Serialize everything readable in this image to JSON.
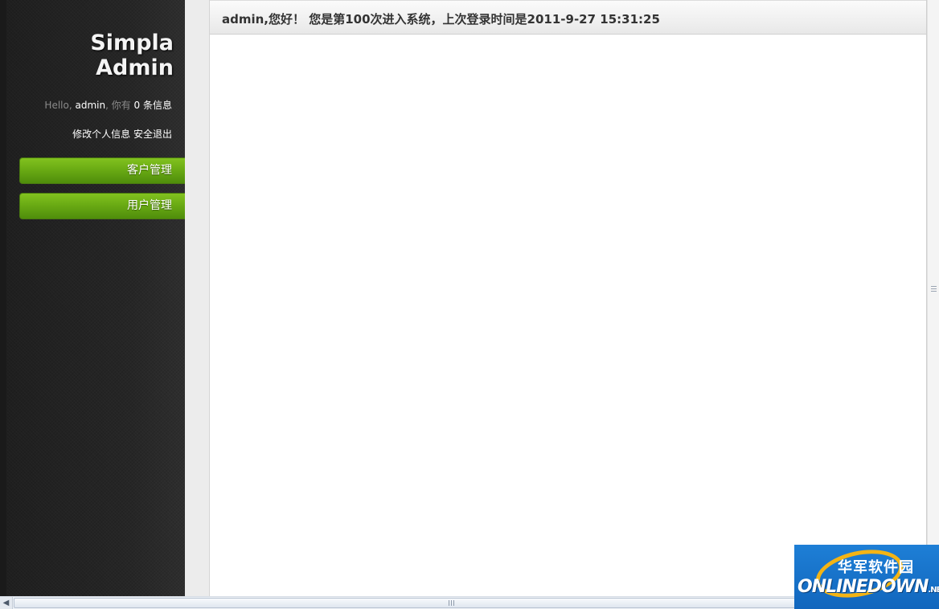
{
  "sidebar": {
    "title": "Simpla Admin",
    "profile": {
      "hello": "Hello, ",
      "username": "admin",
      "mid": ", 你有 ",
      "count": "0",
      "tail": " 条信息"
    },
    "links": {
      "edit_profile": "修改个人信息",
      "logout": "安全退出"
    },
    "nav": [
      {
        "label": "客户管理"
      },
      {
        "label": "用户管理"
      }
    ]
  },
  "main": {
    "welcome": "admin,您好！ 您是第100次进入系统，上次登录时间是2011-9-27 15:31:25"
  },
  "watermark": {
    "cn": "华军软件园",
    "en": "ONLINEDOWN",
    "suffix": ".NET"
  },
  "colors": {
    "nav_green": "#6aab14",
    "sidebar_dark": "#242424",
    "watermark_blue": "#1e7fd6"
  }
}
